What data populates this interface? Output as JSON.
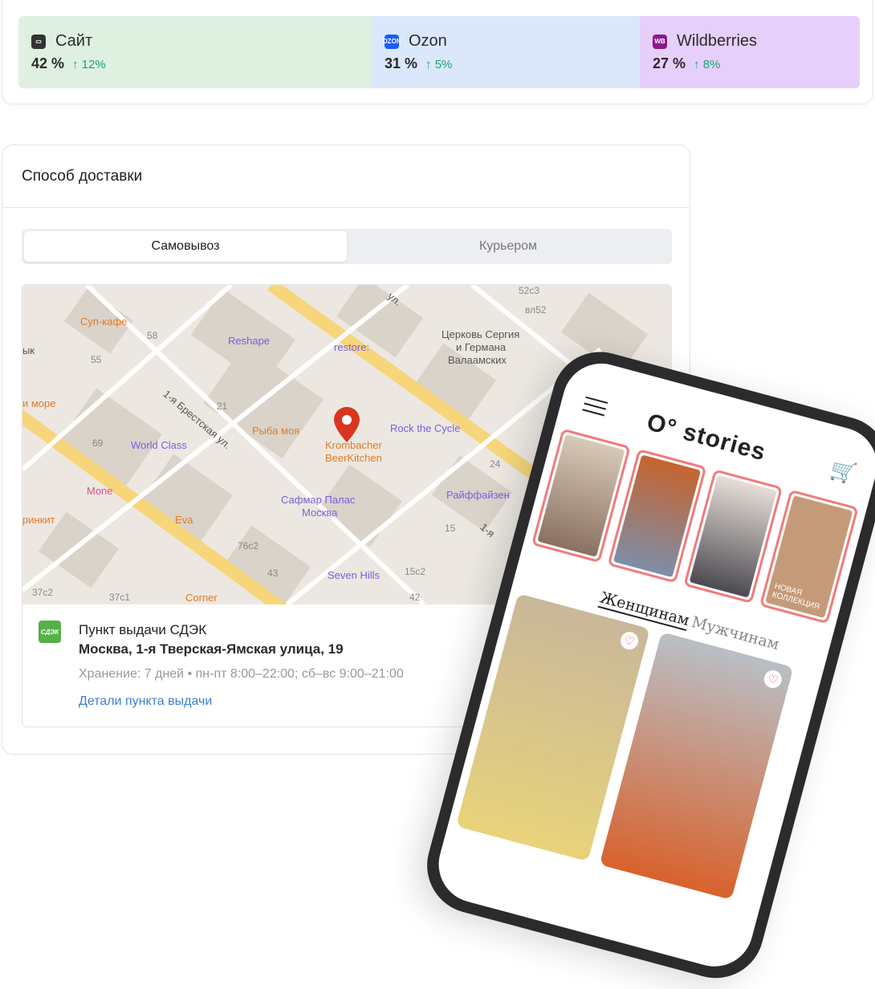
{
  "channels": [
    {
      "name": "Сайт",
      "share": "42 %",
      "delta": "↑ 12%",
      "icon": "monitor-icon",
      "color": "#dff0e1"
    },
    {
      "name": "Ozon",
      "share": "31 %",
      "delta": "↑ 5%",
      "icon": "ozon-logo-icon",
      "icon_text": "OZON",
      "color": "#dbe8fb"
    },
    {
      "name": "Wildberries",
      "share": "27 %",
      "delta": "↑ 8%",
      "icon": "wildberries-logo-icon",
      "icon_text": "WB",
      "color": "#e7cffb"
    }
  ],
  "delivery": {
    "title": "Способ доставки",
    "tabs": [
      "Самовывоз",
      "Курьером"
    ],
    "map_labels": {
      "sup": "Суп-кафе",
      "b58": "58",
      "b55": "55",
      "ryk": "ык",
      "more": "и море",
      "reshape": "Reshape",
      "restore": "restore:",
      "church": "Церковь Сергия",
      "church2": "и Германа",
      "church3": "Валаамских",
      "b52c3": "52с3",
      "vl52": "вл52",
      "street1": "1-я Брестская ул.",
      "b21": "21",
      "ryba": "Рыба моя",
      "kromb": "Krombacher",
      "kromb2": "BeerKitchen",
      "rock": "Rock the Cycle",
      "world": "World Class",
      "b69": "69",
      "mone": "Mone",
      "eva": "Eva",
      "drink": "ринкит",
      "safmar": "Сафмар Палас",
      "safmar2": "Москва",
      "raif": "Райффайзен",
      "b24": "24",
      "b15": "15",
      "street2": "1-я",
      "b76": "76с2",
      "b43": "43",
      "seven": "Seven Hills",
      "b15c2": "15с2",
      "b37c2": "37с2",
      "b37c1": "37с1",
      "corner": "Corner",
      "b42": "42",
      "ul": "ул."
    },
    "point": {
      "logo": "СДЭК",
      "title": "Пункт выдачи СДЭК",
      "address": "Москва, 1-я Тверская-Ямская улица, 19",
      "hours": "Хранение: 7 дней • пн-пт 8:00–22:00; сб–вс 9:00–21:00",
      "link": "Детали пункта выдачи"
    }
  },
  "phone": {
    "logo": "O° stories",
    "story_text": "НОВАЯ КОЛЛЕКЦИЯ",
    "tabs": [
      "Женщинам",
      "Мужчинам"
    ]
  }
}
